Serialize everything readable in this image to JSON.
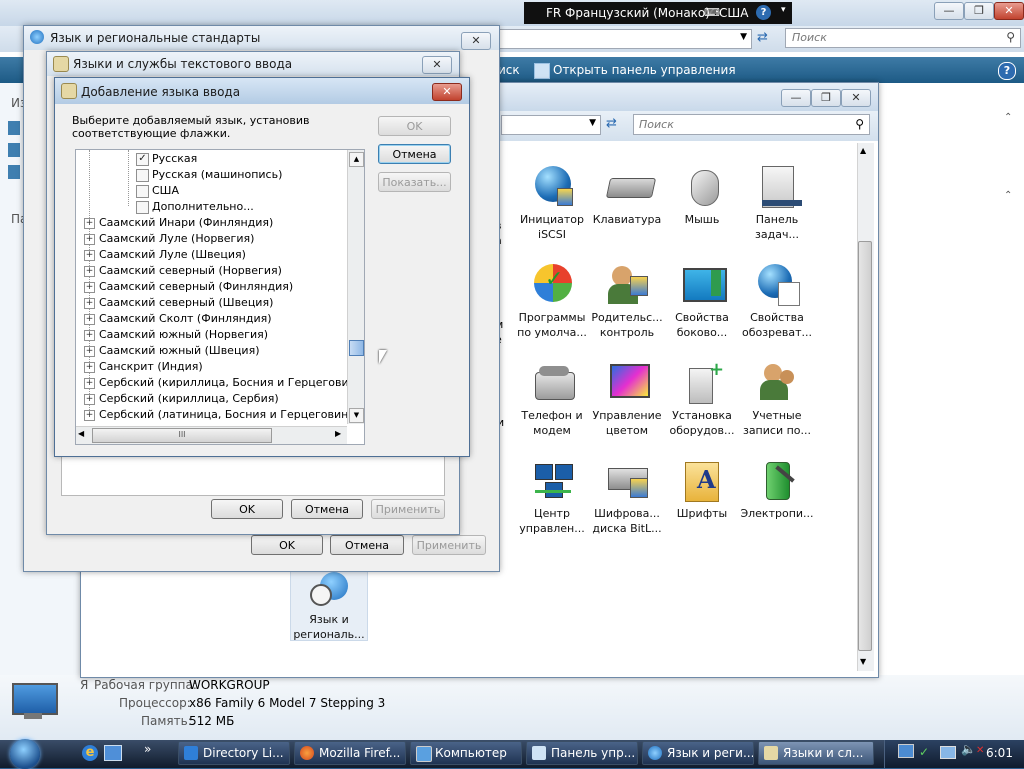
{
  "langbar": {
    "lang": "FR Французский (Монако)",
    "keyboard": "США"
  },
  "explorer": {
    "search_placeholder": "Поиск",
    "toolbar_partial": "иск",
    "toolbar_open_cp": "Открыть панель управления",
    "left_partial_1": "Из",
    "left_partial_2": "Па",
    "details": {
      "workgroup_partial": "Я",
      "workgroup_label": "Рабочая группа:",
      "workgroup_value": "WORKGROUP",
      "cpu_label": "Процессор:",
      "cpu_value": "x86 Family 6 Model 7 Stepping 3",
      "mem_label": "Память:",
      "mem_value": "512 МБ"
    }
  },
  "control_panel": {
    "search_placeholder": "Поиск",
    "items": [
      {
        "label": "Инициатор iSCSI",
        "icon": "iscsi-globe-icon"
      },
      {
        "label": "Клавиатура",
        "icon": "keyboard-icon"
      },
      {
        "label": "Мышь",
        "icon": "mouse-icon"
      },
      {
        "label": "Панель задач...",
        "icon": "taskbar-icon"
      },
      {
        "label": "Программы по умолча...",
        "icon": "default-programs-icon"
      },
      {
        "label": "Родительс... контроль",
        "icon": "parental-control-icon"
      },
      {
        "label": "Свойства боково...",
        "icon": "sidebar-properties-icon"
      },
      {
        "label": "Свойства обозреват...",
        "icon": "internet-options-icon"
      },
      {
        "label": "Телефон и модем",
        "icon": "phone-modem-icon"
      },
      {
        "label": "Управление цветом",
        "icon": "color-management-icon"
      },
      {
        "label": "Установка оборудов...",
        "icon": "add-hardware-icon"
      },
      {
        "label": "Учетные записи по...",
        "icon": "user-accounts-icon"
      },
      {
        "label": "Центр управлен...",
        "icon": "network-center-icon"
      },
      {
        "label": "Шифрова... диска BitL...",
        "icon": "bitlocker-icon"
      },
      {
        "label": "Шрифты",
        "icon": "fonts-icon"
      },
      {
        "label": "Электропи...",
        "icon": "power-options-icon"
      }
    ],
    "partial_left": [
      "в",
      "а",
      "м",
      "е",
      "и"
    ],
    "regional_item": "Язык и региональ..."
  },
  "dlg_regional": {
    "title": "Язык и региональные стандарты",
    "ok": "OK",
    "cancel": "Отмена",
    "apply": "Применить"
  },
  "dlg_text_services": {
    "title": "Языки и службы текстового ввода",
    "ok": "OK",
    "cancel": "Отмена",
    "apply": "Применить"
  },
  "dlg_add_lang": {
    "title": "Добавление языка ввода",
    "instruction": "Выберите добавляемый язык, установив соответствующие флажки.",
    "ok": "OK",
    "cancel": "Отмена",
    "show": "Показать...",
    "checks": [
      {
        "label": "Русская",
        "checked": true
      },
      {
        "label": "Русская (машинопись)",
        "checked": false
      },
      {
        "label": "США",
        "checked": false
      },
      {
        "label": "Дополнительно...",
        "checked": false
      }
    ],
    "langs": [
      "Саамский Инари (Финляндия)",
      "Саамский Луле (Норвегия)",
      "Саамский Луле (Швеция)",
      "Саамский северный (Норвегия)",
      "Саамский северный (Финляндия)",
      "Саамский северный (Швеция)",
      "Саамский Сколт (Финляндия)",
      "Саамский южный (Норвегия)",
      "Саамский южный (Швеция)",
      "Санскрит (Индия)",
      "Сербский (кириллица, Босния и Герцеговина)",
      "Сербский (кириллица, Сербия)",
      "Сербский (латиница, Босния и Герцеговина)"
    ],
    "hscroll_grip": "III"
  },
  "taskbar": {
    "tasks": [
      {
        "label": "Directory Li..."
      },
      {
        "label": "Mozilla Firef..."
      },
      {
        "label": "Компьютер"
      },
      {
        "label": "Панель упр..."
      },
      {
        "label": "Язык и реги..."
      },
      {
        "label": "Языки и сл..."
      }
    ],
    "clock": "6:01",
    "quicklaunch_more": "»"
  },
  "colors": {
    "accent": "#1f5a8a",
    "taskbar": "#1f3352",
    "desktop_green": "#4fae4f"
  }
}
